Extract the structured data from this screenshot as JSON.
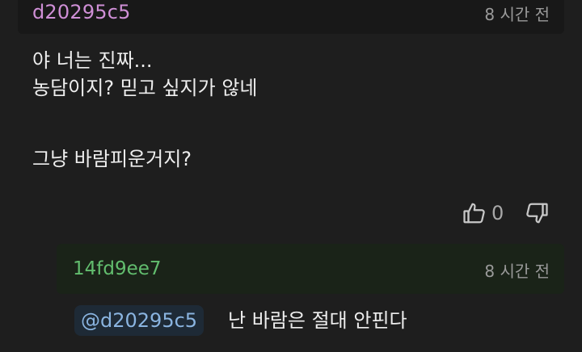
{
  "comment": {
    "author": "d20295c5",
    "time": "8 시간 전",
    "lines": [
      "야 너는 진짜...",
      "농담이지? 믿고 싶지가 않네",
      "그냥 바람피운거지?"
    ],
    "likes": "0"
  },
  "reply": {
    "author": "14fd9ee7",
    "time": "8 시간 전",
    "mention": "@d20295c5",
    "text": "난 바람은 절대 안핀다"
  },
  "colors": {
    "author": "#cf8fd6",
    "reply_author": "#62bd6e",
    "mention": "#8ab4e0",
    "background": "#1e1e1e"
  },
  "icons": [
    "thumbs-up-icon",
    "thumbs-down-icon"
  ]
}
